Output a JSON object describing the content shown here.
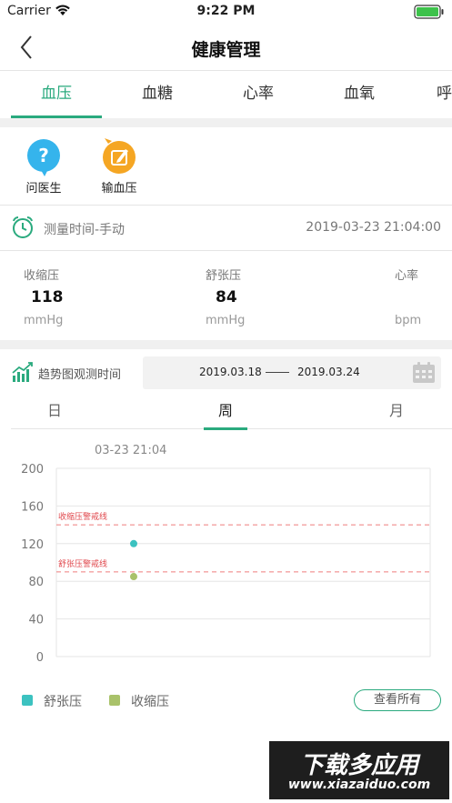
{
  "status_bar": {
    "carrier": "Carrier",
    "time": "9:22 PM"
  },
  "nav": {
    "title": "健康管理"
  },
  "tabs": [
    {
      "label": "血压",
      "active": true
    },
    {
      "label": "血糖",
      "active": false
    },
    {
      "label": "心率",
      "active": false
    },
    {
      "label": "血氧",
      "active": false
    },
    {
      "label": "呼",
      "active": false
    }
  ],
  "actions": [
    {
      "label": "问医生",
      "icon": "question-bubble-icon",
      "color": "#35b4ec"
    },
    {
      "label": "输血压",
      "icon": "edit-bubble-icon",
      "color": "#f5a623"
    }
  ],
  "measurement": {
    "mode": "测量时间-手动",
    "timestamp": "2019-03-23 21:04:00"
  },
  "readings": [
    {
      "label": "收缩压",
      "value": "118",
      "unit": "mmHg"
    },
    {
      "label": "舒张压",
      "value": "84",
      "unit": "mmHg"
    },
    {
      "label": "心率",
      "value": "",
      "unit": "bpm"
    }
  ],
  "trend": {
    "label": "趋势图观测时间",
    "date_from": "2019.03.18",
    "date_to": "2019.03.24"
  },
  "period_tabs": [
    {
      "label": "日",
      "active": false
    },
    {
      "label": "周",
      "active": true
    },
    {
      "label": "月",
      "active": false
    }
  ],
  "chart_data": {
    "type": "scatter",
    "timestamp_label": "03-23 21:04",
    "ylim": [
      0,
      200
    ],
    "yticks": [
      "200",
      "160",
      "120",
      "80",
      "40",
      "0"
    ],
    "threshold_lines": [
      {
        "label": "收缩压警戒线",
        "value": 140,
        "color": "#ef7c7c"
      },
      {
        "label": "舒张压警戒线",
        "value": 90,
        "color": "#ef7c7c"
      }
    ],
    "series": [
      {
        "name": "舒张压",
        "color": "#3cc2c0",
        "points": [
          {
            "y": 120
          }
        ]
      },
      {
        "name": "收缩压",
        "color": "#a9c26a",
        "points": [
          {
            "y": 85
          }
        ]
      }
    ]
  },
  "legend": [
    {
      "label": "舒张压",
      "color": "#3cc2c0"
    },
    {
      "label": "收缩压",
      "color": "#a9c26a"
    }
  ],
  "view_all_label": "查看所有",
  "watermark": {
    "title": "下载多应用",
    "url": "www.xiazaiduo.com"
  },
  "colors": {
    "accent": "#2aaa7e",
    "warning_line": "#ef7c7c"
  }
}
